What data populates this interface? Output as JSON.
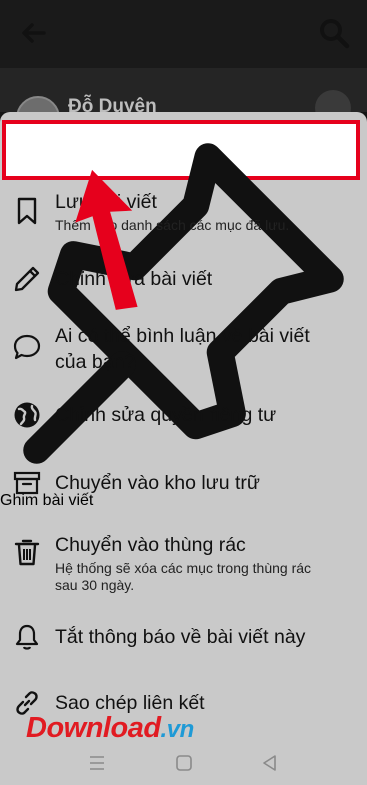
{
  "post": {
    "author": "Đỗ Duyên"
  },
  "menu": {
    "pin": {
      "label": "Ghim bài viết"
    },
    "save": {
      "label": "Lưu bài viết",
      "sub": "Thêm vào danh sách các mục đã lưu."
    },
    "edit": {
      "label": "Chỉnh sửa bài viết"
    },
    "comment": {
      "label_line1": "Ai có thể bình luận về bài viết",
      "label_line2": "của bạn?"
    },
    "privacy": {
      "label": "Chỉnh sửa quyền riêng tư"
    },
    "archive": {
      "label": "Chuyển vào kho lưu trữ"
    },
    "trash": {
      "label": "Chuyển vào thùng rác",
      "sub_line1": "Hệ thống sẽ xóa các mục trong thùng rác",
      "sub_line2": "sau 30 ngày."
    },
    "notify": {
      "label": "Tắt thông báo về bài viết này"
    },
    "copy": {
      "label": "Sao chép liên kết"
    }
  },
  "watermark": {
    "part1": "Download",
    "part2": ".vn"
  },
  "colors": {
    "highlight": "#e6001c",
    "sheet": "#c9c9c9",
    "topbar": "#1a1a1a"
  },
  "icons": [
    "back-arrow-icon",
    "search-icon",
    "pin-icon",
    "bookmark-icon",
    "pencil-icon",
    "comment-icon",
    "globe-icon",
    "archive-icon",
    "trash-icon",
    "bell-icon",
    "link-icon",
    "menu-lines-icon",
    "home-square-icon",
    "back-triangle-icon"
  ]
}
